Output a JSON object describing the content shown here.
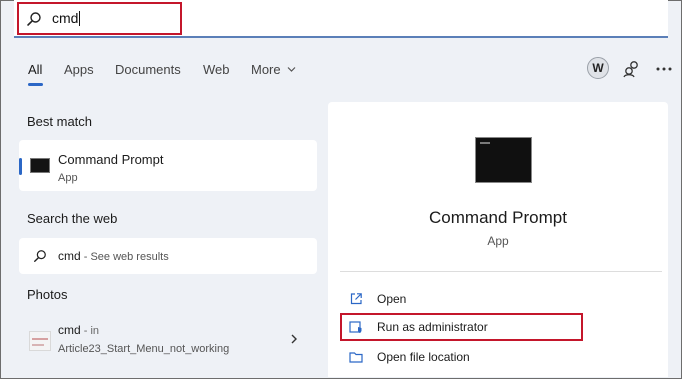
{
  "search": {
    "query": "cmd"
  },
  "tabs": [
    {
      "label": "All",
      "active": true
    },
    {
      "label": "Apps"
    },
    {
      "label": "Documents"
    },
    {
      "label": "Web"
    },
    {
      "label": "More"
    }
  ],
  "account": {
    "initial": "W"
  },
  "colors": {
    "accent": "#2b67c6",
    "highlight_box": "#c4162b"
  },
  "best_match": {
    "heading": "Best match",
    "title": "Command Prompt",
    "subtitle": "App",
    "icon": "command-prompt-icon"
  },
  "search_web": {
    "heading": "Search the web",
    "query": "cmd",
    "suffix": " - See web results",
    "icon": "search-icon"
  },
  "photos": {
    "heading": "Photos",
    "title": "cmd",
    "title_suffix": " - in",
    "location": "Article23_Start_Menu_not_working"
  },
  "details": {
    "title": "Command Prompt",
    "subtitle": "App",
    "actions": [
      {
        "label": "Open",
        "icon": "open-external-icon"
      },
      {
        "label": "Run as administrator",
        "icon": "admin-shield-icon"
      },
      {
        "label": "Open file location",
        "icon": "folder-icon"
      }
    ]
  }
}
